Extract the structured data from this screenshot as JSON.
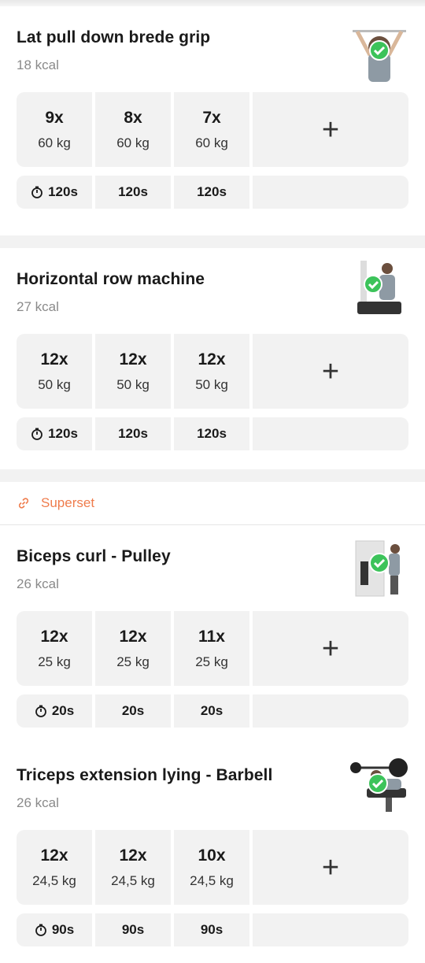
{
  "colors": {
    "accent": "#ef7c4c",
    "check": "#3cc35a",
    "cell_bg": "#f2f2f2"
  },
  "add_icon": "plus-icon",
  "exercises": [
    {
      "title": "Lat pull down brede grip",
      "kcal": "18 kcal",
      "sets": [
        {
          "reps": "9x",
          "weight": "60 kg"
        },
        {
          "reps": "8x",
          "weight": "60 kg"
        },
        {
          "reps": "7x",
          "weight": "60 kg"
        }
      ],
      "rests": [
        "120s",
        "120s",
        "120s"
      ],
      "completed": true
    },
    {
      "title": "Horizontal row machine",
      "kcal": "27 kcal",
      "sets": [
        {
          "reps": "12x",
          "weight": "50 kg"
        },
        {
          "reps": "12x",
          "weight": "50 kg"
        },
        {
          "reps": "12x",
          "weight": "50 kg"
        }
      ],
      "rests": [
        "120s",
        "120s",
        "120s"
      ],
      "completed": true
    },
    {
      "title": "Biceps curl - Pulley",
      "kcal": "26 kcal",
      "sets": [
        {
          "reps": "12x",
          "weight": "25 kg"
        },
        {
          "reps": "12x",
          "weight": "25 kg"
        },
        {
          "reps": "11x",
          "weight": "25 kg"
        }
      ],
      "rests": [
        "20s",
        "20s",
        "20s"
      ],
      "completed": true
    },
    {
      "title": "Triceps extension lying - Barbell",
      "kcal": "26 kcal",
      "sets": [
        {
          "reps": "12x",
          "weight": "24,5 kg"
        },
        {
          "reps": "12x",
          "weight": "24,5 kg"
        },
        {
          "reps": "10x",
          "weight": "24,5 kg"
        }
      ],
      "rests": [
        "90s",
        "90s",
        "90s"
      ],
      "completed": true
    }
  ],
  "superset_label": "Superset"
}
